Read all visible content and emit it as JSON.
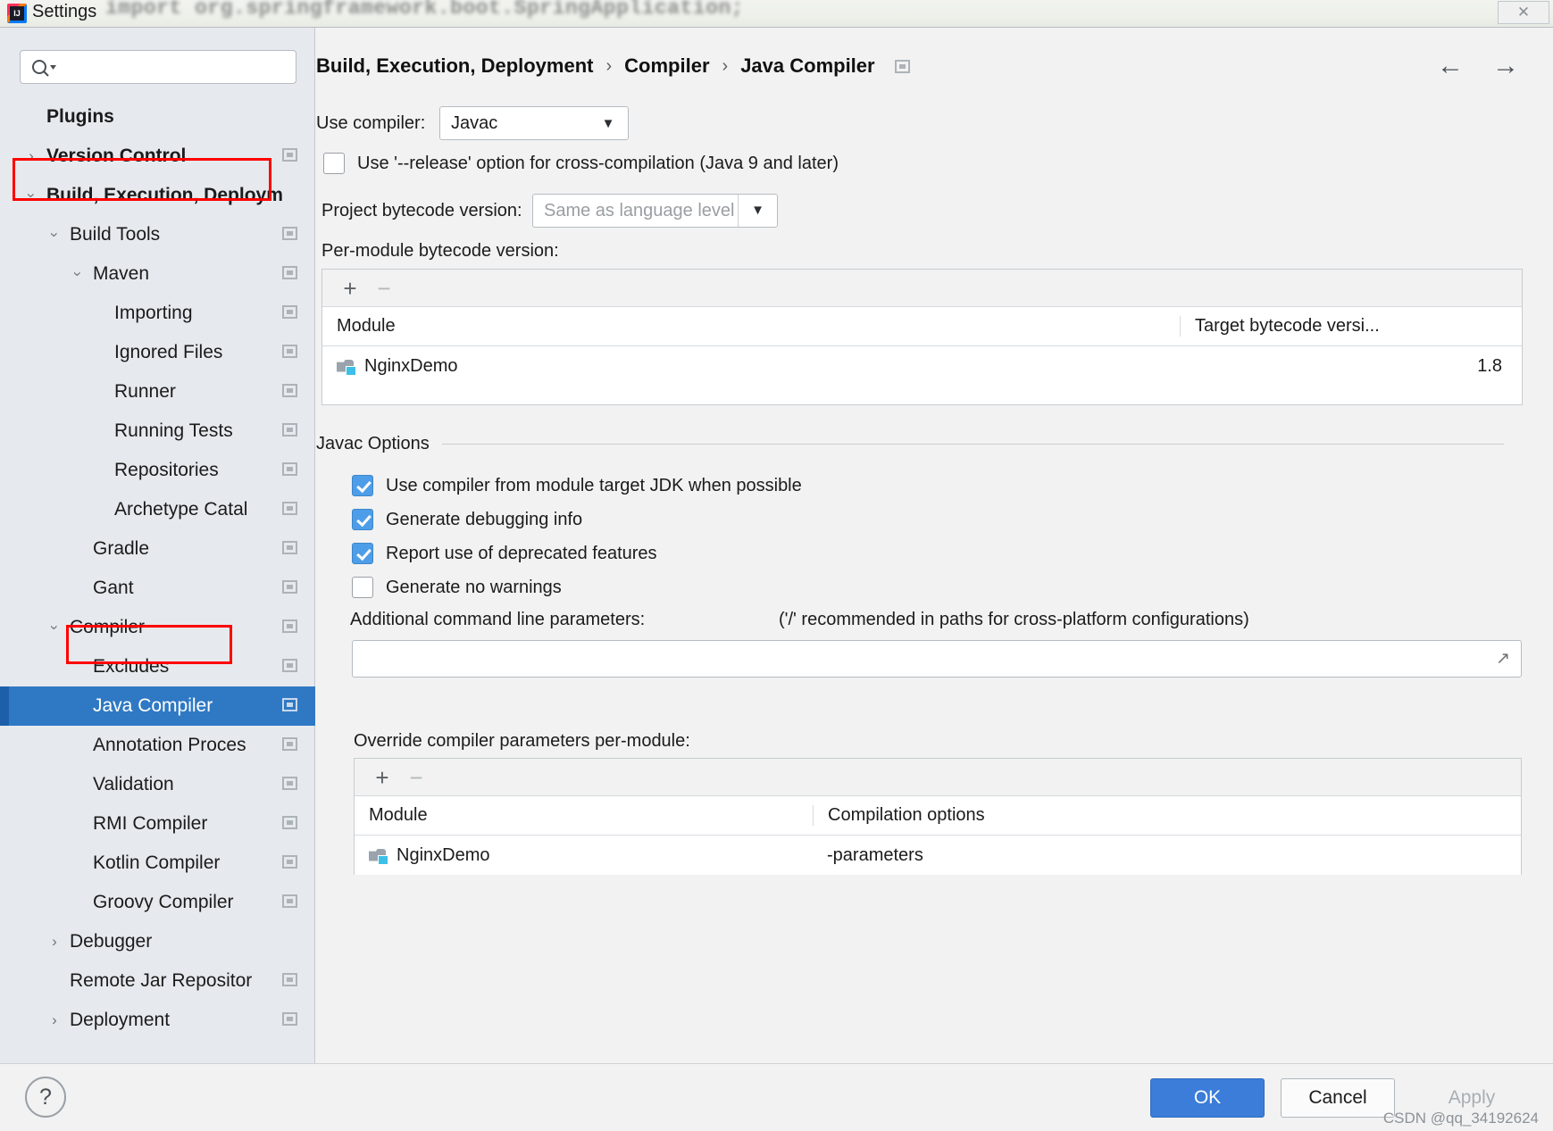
{
  "window": {
    "title": "Settings",
    "backdrop_code": "import org.springframework.boot.SpringApplication;",
    "close_label": "✕"
  },
  "sidebar": {
    "search": {
      "placeholder": "",
      "value": ""
    },
    "items": [
      {
        "label": "Plugins",
        "indent": 52,
        "arrow": "",
        "bold": true,
        "badge": false,
        "selected": false
      },
      {
        "label": "Version Control",
        "indent": 52,
        "arrow": "right",
        "bold": true,
        "badge": true,
        "selected": false
      },
      {
        "label": "Build, Execution, Deploym",
        "indent": 52,
        "arrow": "down",
        "bold": true,
        "badge": false,
        "selected": false
      },
      {
        "label": "Build Tools",
        "indent": 78,
        "arrow": "down",
        "bold": false,
        "badge": true,
        "selected": false
      },
      {
        "label": "Maven",
        "indent": 104,
        "arrow": "down",
        "bold": false,
        "badge": true,
        "selected": false
      },
      {
        "label": "Importing",
        "indent": 128,
        "arrow": "",
        "bold": false,
        "badge": true,
        "selected": false
      },
      {
        "label": "Ignored Files",
        "indent": 128,
        "arrow": "",
        "bold": false,
        "badge": true,
        "selected": false
      },
      {
        "label": "Runner",
        "indent": 128,
        "arrow": "",
        "bold": false,
        "badge": true,
        "selected": false
      },
      {
        "label": "Running Tests",
        "indent": 128,
        "arrow": "",
        "bold": false,
        "badge": true,
        "selected": false
      },
      {
        "label": "Repositories",
        "indent": 128,
        "arrow": "",
        "bold": false,
        "badge": true,
        "selected": false
      },
      {
        "label": "Archetype Catal",
        "indent": 128,
        "arrow": "",
        "bold": false,
        "badge": true,
        "selected": false
      },
      {
        "label": "Gradle",
        "indent": 104,
        "arrow": "",
        "bold": false,
        "badge": true,
        "selected": false
      },
      {
        "label": "Gant",
        "indent": 104,
        "arrow": "",
        "bold": false,
        "badge": true,
        "selected": false
      },
      {
        "label": "Compiler",
        "indent": 78,
        "arrow": "down",
        "bold": false,
        "badge": true,
        "selected": false
      },
      {
        "label": "Excludes",
        "indent": 104,
        "arrow": "",
        "bold": false,
        "badge": true,
        "selected": false
      },
      {
        "label": "Java Compiler",
        "indent": 104,
        "arrow": "",
        "bold": false,
        "badge": true,
        "selected": true
      },
      {
        "label": "Annotation Proces",
        "indent": 104,
        "arrow": "",
        "bold": false,
        "badge": true,
        "selected": false
      },
      {
        "label": "Validation",
        "indent": 104,
        "arrow": "",
        "bold": false,
        "badge": true,
        "selected": false
      },
      {
        "label": "RMI Compiler",
        "indent": 104,
        "arrow": "",
        "bold": false,
        "badge": true,
        "selected": false
      },
      {
        "label": "Kotlin Compiler",
        "indent": 104,
        "arrow": "",
        "bold": false,
        "badge": true,
        "selected": false
      },
      {
        "label": "Groovy Compiler",
        "indent": 104,
        "arrow": "",
        "bold": false,
        "badge": true,
        "selected": false
      },
      {
        "label": "Debugger",
        "indent": 78,
        "arrow": "right",
        "bold": false,
        "badge": false,
        "selected": false
      },
      {
        "label": "Remote Jar Repositor",
        "indent": 78,
        "arrow": "",
        "bold": false,
        "badge": true,
        "selected": false
      },
      {
        "label": "Deployment",
        "indent": 78,
        "arrow": "right",
        "bold": false,
        "badge": true,
        "selected": false
      }
    ]
  },
  "breadcrumb": {
    "part1": "Build, Execution, Deployment",
    "sep1": "›",
    "part2": "Compiler",
    "sep2": "›",
    "part3": "Java Compiler"
  },
  "nav": {
    "back": "←",
    "forward": "→"
  },
  "main": {
    "use_compiler_label": "Use compiler:",
    "use_compiler_value": "Javac",
    "release_option_label": "Use '--release' option for cross-compilation (Java 9 and later)",
    "release_option_checked": false,
    "project_bytecode_label": "Project bytecode version:",
    "project_bytecode_value": "Same as language level",
    "per_module_label": "Per-module bytecode version:",
    "bytecode_table": {
      "add": "+",
      "remove": "−",
      "columns": [
        "Module",
        "Target bytecode versi..."
      ],
      "rows": [
        {
          "module": "NginxDemo",
          "target": "1.8"
        }
      ]
    },
    "javac_options_title": "Javac Options",
    "options": [
      {
        "label": "Use compiler from module target JDK when possible",
        "checked": true
      },
      {
        "label": "Generate debugging info",
        "checked": true
      },
      {
        "label": "Report use of deprecated features",
        "checked": true
      },
      {
        "label": "Generate no warnings",
        "checked": false
      }
    ],
    "additional_params_label": "Additional command line parameters:",
    "additional_params_hint": "('/' recommended in paths for cross-platform configurations)",
    "additional_params_value": "",
    "override_label": "Override compiler parameters per-module:",
    "override_table": {
      "add": "+",
      "remove": "−",
      "columns": [
        "Module",
        "Compilation options"
      ],
      "rows": [
        {
          "module": "NginxDemo",
          "options": "-parameters"
        }
      ]
    }
  },
  "footer": {
    "help": "?",
    "ok": "OK",
    "cancel": "Cancel",
    "apply": "Apply"
  },
  "watermark": "CSDN @qq_34192624",
  "colors": {
    "selection_blue": "#2f79c4",
    "primary_button": "#3b7dd8",
    "annotation_red": "#ff0000",
    "checkbox_blue": "#4d9de8"
  }
}
